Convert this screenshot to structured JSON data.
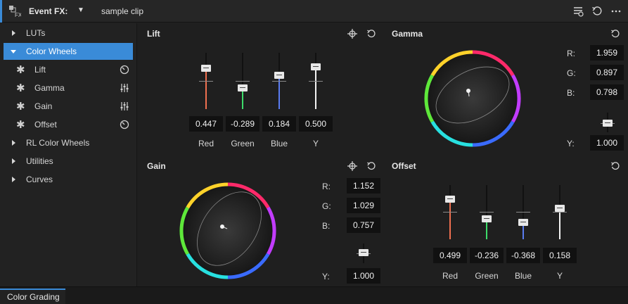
{
  "header": {
    "event_label": "Event FX:",
    "clip_name": "sample clip"
  },
  "sidebar": {
    "items": [
      {
        "label": "LUTs",
        "expanded": false
      },
      {
        "label": "Color Wheels",
        "expanded": true,
        "selected": true
      },
      {
        "label": "Lift",
        "icon": "reset-icon"
      },
      {
        "label": "Gamma",
        "icon": "sliders-icon"
      },
      {
        "label": "Gain",
        "icon": "sliders-icon"
      },
      {
        "label": "Offset",
        "icon": "reset-icon"
      },
      {
        "label": "RL Color Wheels",
        "expanded": false
      },
      {
        "label": "Utilities",
        "expanded": false
      },
      {
        "label": "Curves",
        "expanded": false
      }
    ]
  },
  "lift": {
    "title": "Lift",
    "channels": [
      {
        "label": "Red",
        "value": "0.447",
        "color": "#f07050"
      },
      {
        "label": "Green",
        "value": "-0.289",
        "color": "#3ddc6a"
      },
      {
        "label": "Blue",
        "value": "0.184",
        "color": "#5a7cf0"
      },
      {
        "label": "Y",
        "value": "0.500",
        "color": "#f2f2f2"
      }
    ]
  },
  "gamma": {
    "title": "Gamma",
    "r_label": "R:",
    "r_value": "1.959",
    "g_label": "G:",
    "g_value": "0.897",
    "b_label": "B:",
    "b_value": "0.798",
    "y_label": "Y:",
    "y_value": "1.000"
  },
  "gain": {
    "title": "Gain",
    "r_label": "R:",
    "r_value": "1.152",
    "g_label": "G:",
    "g_value": "1.029",
    "b_label": "B:",
    "b_value": "0.757",
    "y_label": "Y:",
    "y_value": "1.000"
  },
  "offset": {
    "title": "Offset",
    "channels": [
      {
        "label": "Red",
        "value": "0.499",
        "color": "#f07050"
      },
      {
        "label": "Green",
        "value": "-0.236",
        "color": "#3ddc6a"
      },
      {
        "label": "Blue",
        "value": "-0.368",
        "color": "#5a7cf0"
      },
      {
        "label": "Y",
        "value": "0.158",
        "color": "#f2f2f2"
      }
    ]
  },
  "footer": {
    "tab_label": "Color Grading"
  },
  "colors": {
    "accent": "#3a8bd8",
    "panel_bg": "#1f1f1f",
    "value_bg": "#111111"
  }
}
